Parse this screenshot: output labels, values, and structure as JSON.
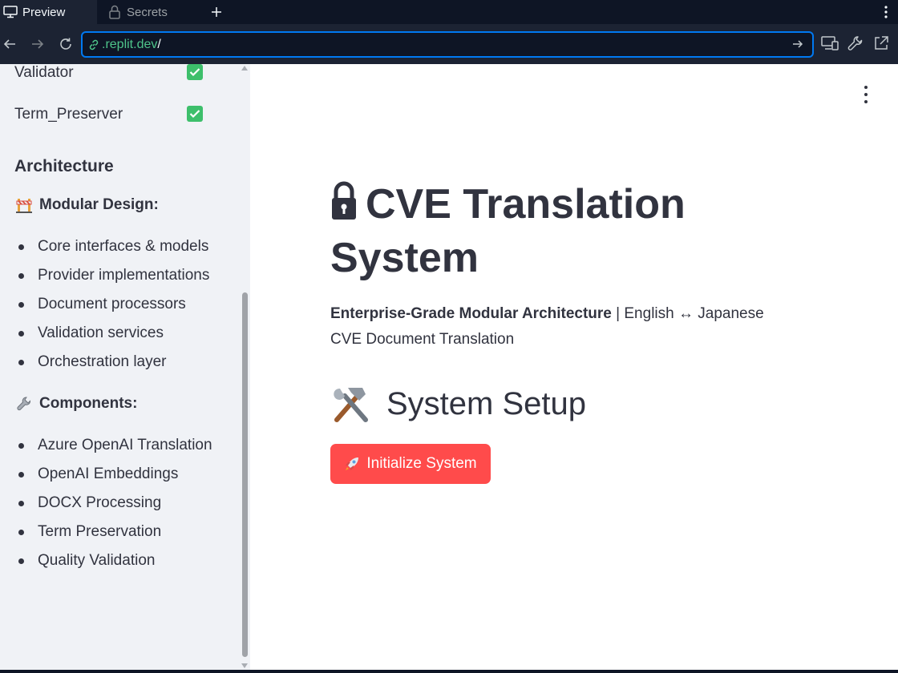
{
  "tabs": [
    {
      "label": "Preview",
      "icon": "monitor-icon"
    },
    {
      "label": "Secrets",
      "icon": "lock-icon"
    }
  ],
  "url": {
    "host": ".replit.dev",
    "path": "/"
  },
  "sidebar": {
    "toggles": [
      {
        "label": "Validator",
        "checked": true
      },
      {
        "label": "Term_Preserver",
        "checked": true
      }
    ],
    "architecture_heading": "Architecture",
    "modular_heading": "Modular Design:",
    "modular_items": [
      "Core interfaces & models",
      "Provider implementations",
      "Document processors",
      "Validation services",
      "Orchestration layer"
    ],
    "components_heading": "Components:",
    "component_items": [
      "Azure OpenAI Translation",
      "OpenAI Embeddings",
      "DOCX Processing",
      "Term Preservation",
      "Quality Validation"
    ]
  },
  "main": {
    "title": "CVE Translation System",
    "subtitle_bold": "Enterprise-Grade Modular Architecture",
    "subtitle_rest": " | English ↔ Japanese CVE Document Translation",
    "setup_heading": "System Setup",
    "init_button": "Initialize System"
  },
  "colors": {
    "accent": "#0079f2",
    "primary_button": "#ff4b4b",
    "checkbox": "#3dbf6b",
    "sidebar_bg": "#f0f2f6",
    "text": "#31333f"
  }
}
